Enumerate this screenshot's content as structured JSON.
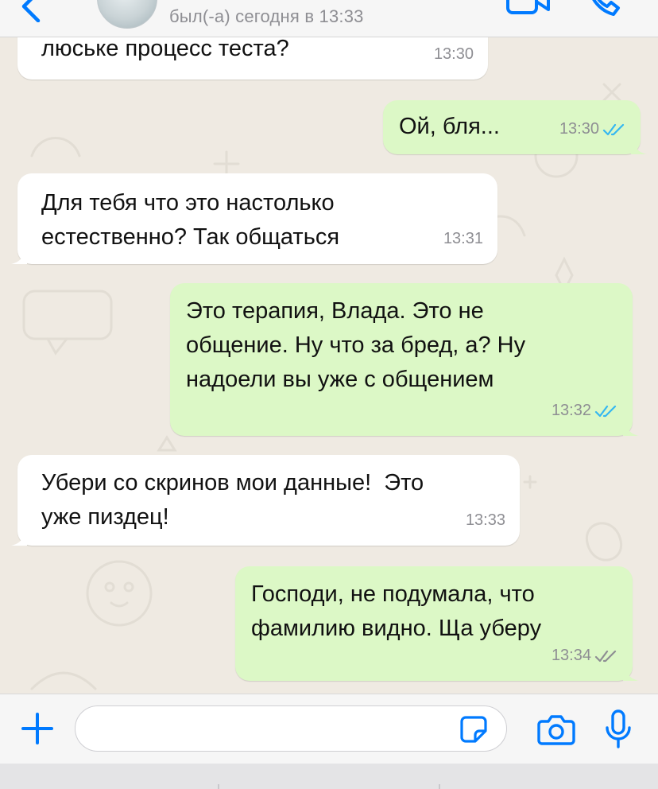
{
  "header": {
    "last_seen": "был(-а) сегодня в 13:33"
  },
  "messages": [
    {
      "id": "m1",
      "direction": "incoming",
      "text": "люське процесс теста?",
      "time": "13:30"
    },
    {
      "id": "m2",
      "direction": "outgoing",
      "text": "Ой, бля...",
      "time": "13:30",
      "status": "read"
    },
    {
      "id": "m3",
      "direction": "incoming",
      "text": "Для тебя что это настолько\nестественно? Так общаться",
      "time": "13:31"
    },
    {
      "id": "m4",
      "direction": "outgoing",
      "text": "Это терапия, Влада. Это не\nобщение. Ну что за бред, а? Ну\nнадоели вы уже с общением",
      "time": "13:32",
      "status": "read"
    },
    {
      "id": "m5",
      "direction": "incoming",
      "text": "Убери со скринов мои данные!  Это\nуже пиздец!",
      "time": "13:33"
    },
    {
      "id": "m6",
      "direction": "outgoing",
      "text": "Господи, не подумала, что\nфамилию видно. Ща уберу",
      "time": "13:34",
      "status": "delivered"
    }
  ],
  "input": {
    "value": "",
    "placeholder": ""
  },
  "colors": {
    "accent": "#007aff",
    "outgoing_bubble": "#dcf8c6",
    "incoming_bubble": "#ffffff",
    "read_ticks": "#34b7f1",
    "delivered_ticks": "#8e8e93",
    "wallpaper": "#efeae2"
  },
  "icons": [
    "back-icon",
    "avatar",
    "video-call-icon",
    "voice-call-icon",
    "plus-icon",
    "sticker-icon",
    "camera-icon",
    "microphone-icon"
  ]
}
